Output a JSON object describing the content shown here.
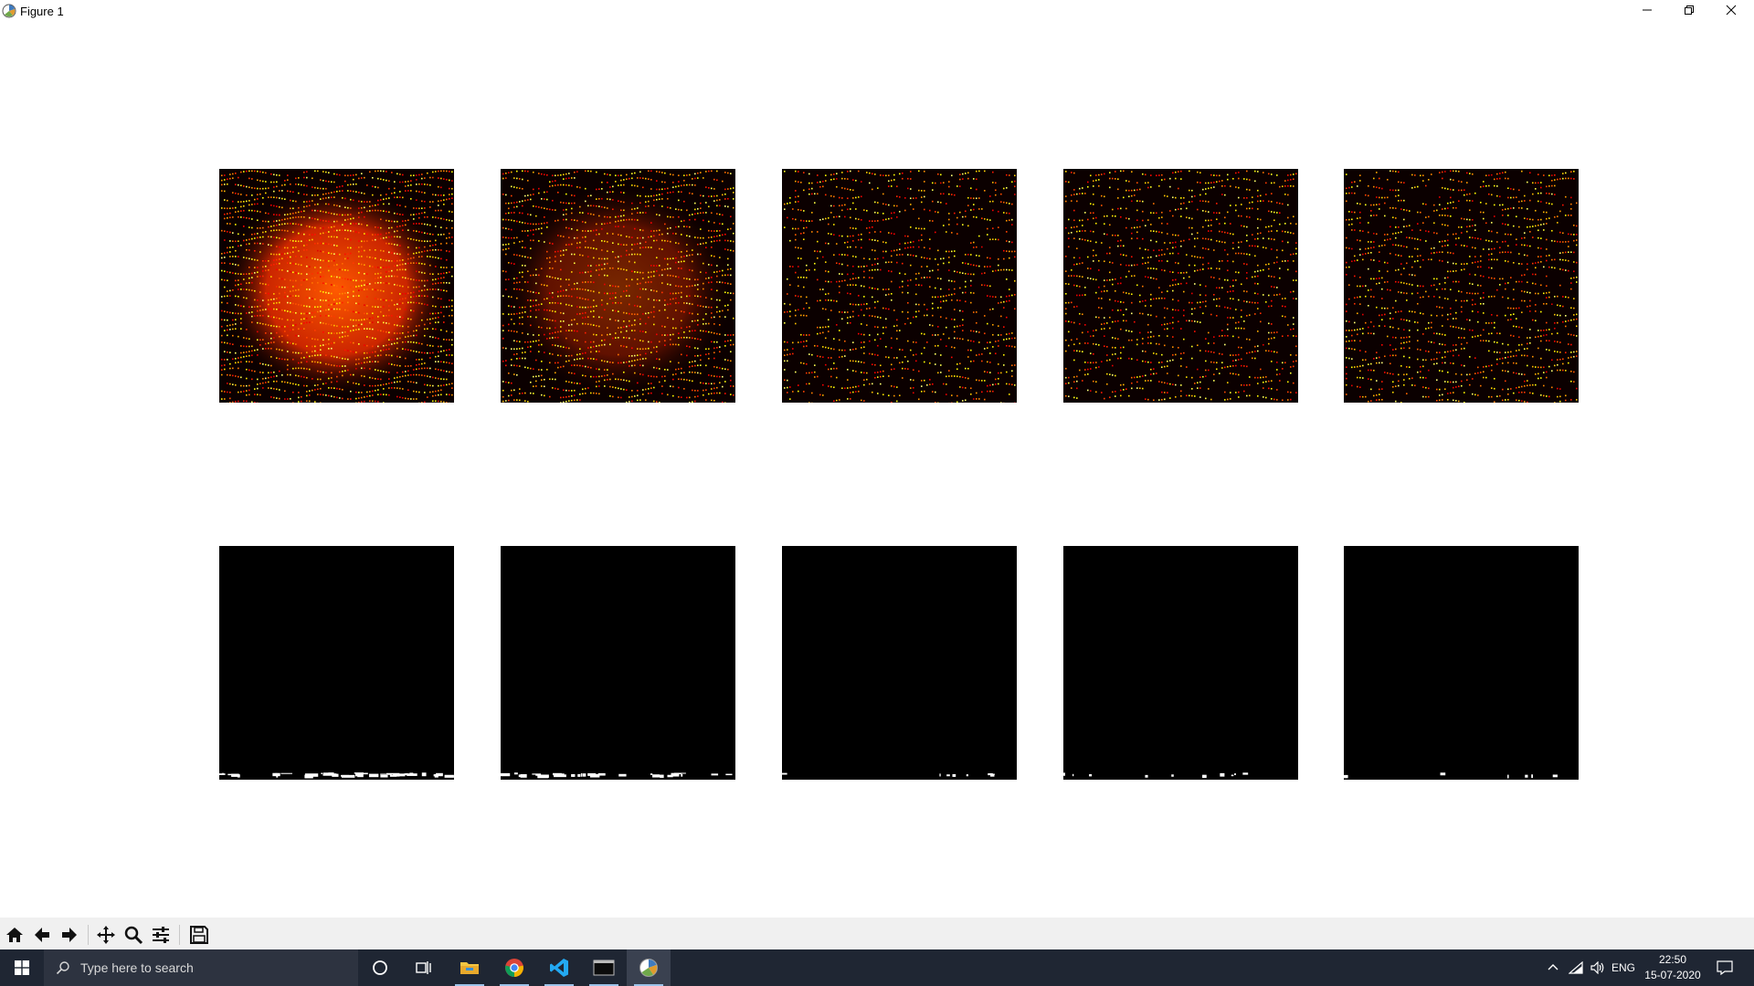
{
  "window": {
    "title": "Figure 1",
    "icons": {
      "app": "matplotlib-icon",
      "minimize": "minimize-icon",
      "restore": "restore-icon",
      "close": "close-icon"
    }
  },
  "figure": {
    "rows": 2,
    "cols": 5,
    "top_row_colormap": "hot",
    "bottom_row_colormap": "gray"
  },
  "toolbar": {
    "buttons": [
      {
        "name": "home",
        "icon": "home-icon"
      },
      {
        "name": "back",
        "icon": "arrow-left-icon"
      },
      {
        "name": "forward",
        "icon": "arrow-right-icon"
      },
      {
        "name": "pan",
        "icon": "pan-icon"
      },
      {
        "name": "zoom",
        "icon": "zoom-icon"
      },
      {
        "name": "configure-subplots",
        "icon": "sliders-icon"
      },
      {
        "name": "save",
        "icon": "save-icon"
      }
    ]
  },
  "taskbar": {
    "search_placeholder": "Type here to search",
    "apps": [
      {
        "name": "cortana",
        "icon": "cortana-icon"
      },
      {
        "name": "task-view",
        "icon": "task-view-icon"
      },
      {
        "name": "file-explorer",
        "icon": "folder-icon"
      },
      {
        "name": "chrome",
        "icon": "chrome-icon"
      },
      {
        "name": "vscode",
        "icon": "vscode-icon"
      },
      {
        "name": "terminal",
        "icon": "terminal-icon"
      },
      {
        "name": "matplotlib-figure",
        "icon": "matplotlib-icon"
      }
    ],
    "tray": {
      "language": "ENG",
      "time": "22:50",
      "date": "15-07-2020"
    }
  },
  "colors": {
    "taskbar": "#1f2633",
    "toolbar": "#f0f0f0",
    "panel_dark": "#0b0000"
  }
}
